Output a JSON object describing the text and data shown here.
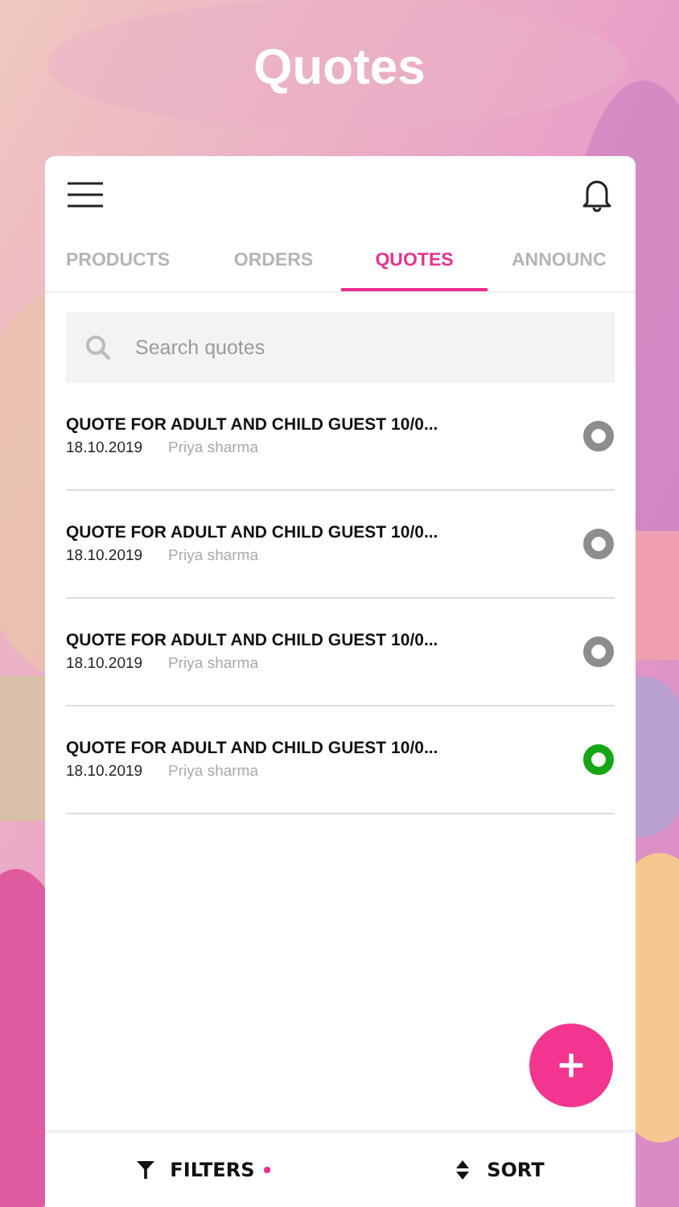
{
  "title": "Quotes",
  "tabs": [
    {
      "label": "PRODUCTS",
      "selected": false
    },
    {
      "label": "ORDERS",
      "selected": false
    },
    {
      "label": "QUOTES",
      "selected": true
    },
    {
      "label": "ANNOUNC",
      "selected": false
    }
  ],
  "search": {
    "placeholder": "Search quotes"
  },
  "quotes": [
    {
      "title": "QUOTE FOR ADULT AND CHILD GUEST 10/0...",
      "date": "18.10.2019",
      "author": "Priya sharma",
      "color": "#8d8d8d"
    },
    {
      "title": "QUOTE FOR ADULT AND CHILD GUEST 10/0...",
      "date": "18.10.2019",
      "author": "Priya sharma",
      "color": "#8d8d8d"
    },
    {
      "title": "QUOTE FOR ADULT AND CHILD GUEST 10/0...",
      "date": "18.10.2019",
      "author": "Priya sharma",
      "color": "#8d8d8d"
    },
    {
      "title": "QUOTE FOR ADULT AND CHILD GUEST 10/0...",
      "date": "18.10.2019",
      "author": "Priya sharma",
      "color": "#14a614"
    }
  ],
  "bottom_bar": {
    "filters": {
      "label": "FILTERS",
      "active": true
    },
    "sort": {
      "label": "SORT"
    }
  }
}
